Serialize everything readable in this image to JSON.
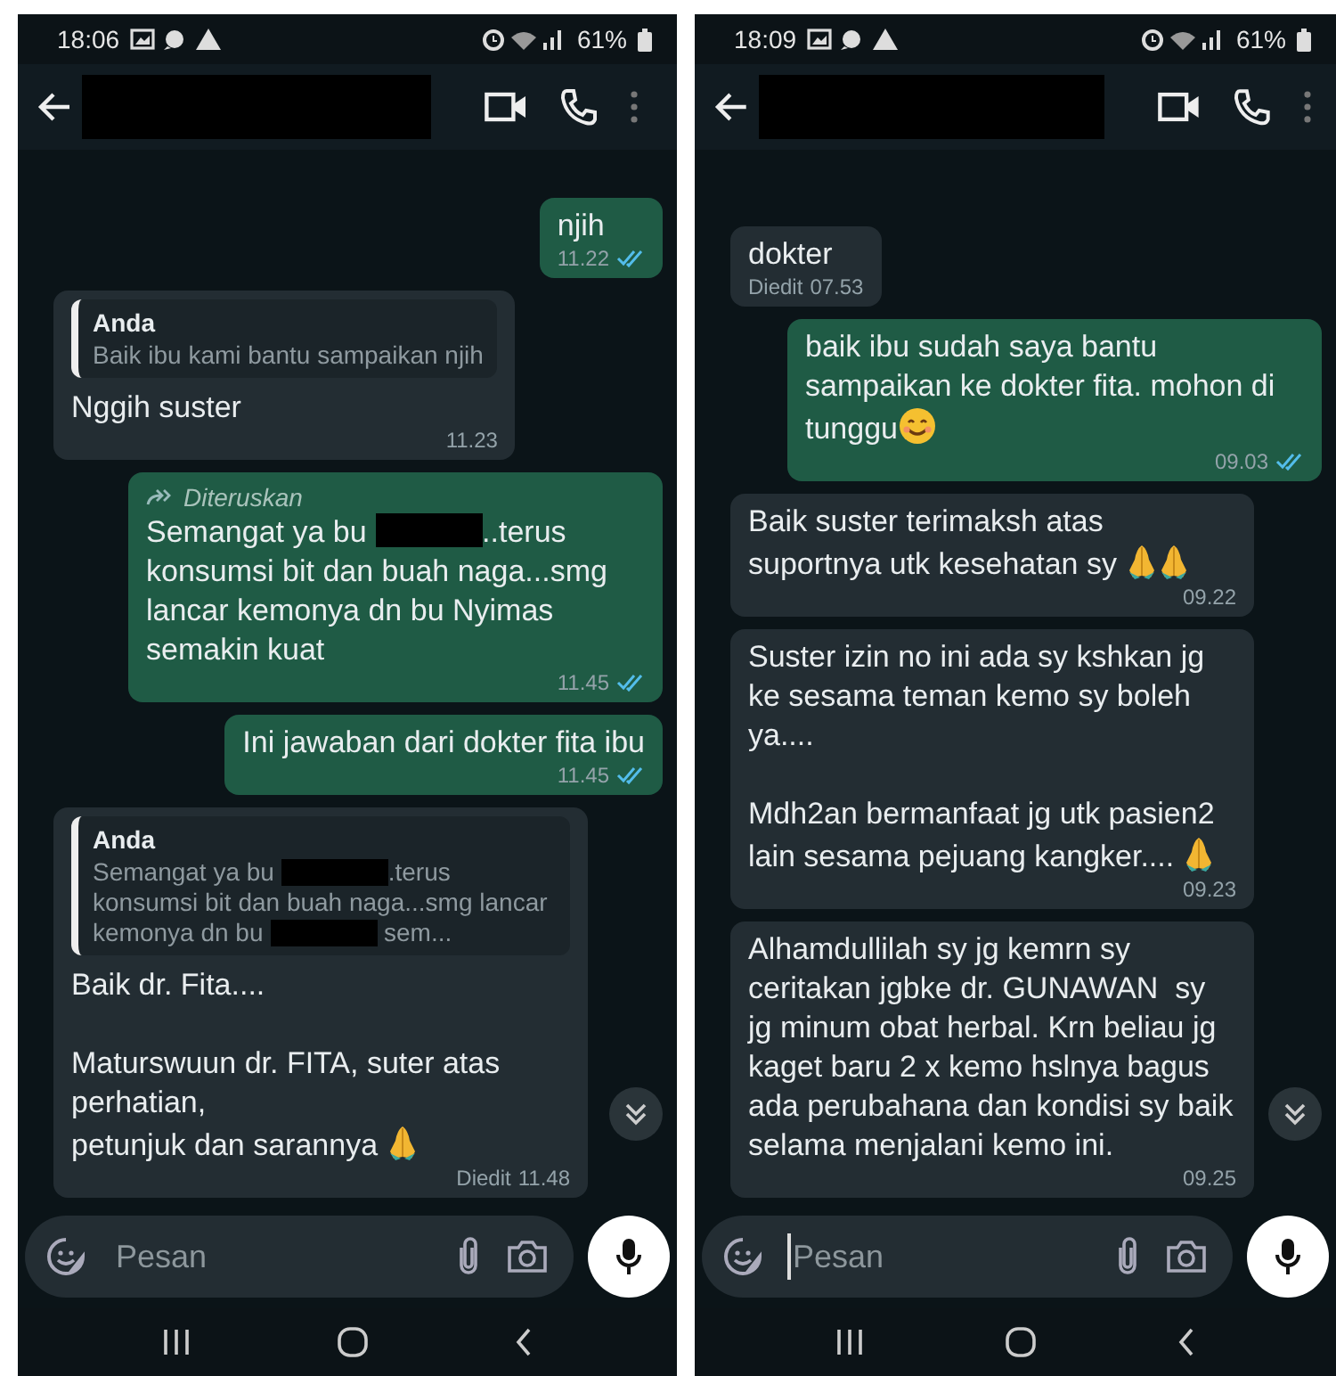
{
  "screens": [
    {
      "status_bar": {
        "time": "18:06",
        "battery": "61%"
      },
      "messages": [
        {
          "kind": "outgoing",
          "body": [
            {
              "kind": "text",
              "text": "njih"
            }
          ],
          "time": "11.22",
          "read": true
        },
        {
          "kind": "incoming",
          "quote": {
            "author": "Anda",
            "body": [
              {
                "kind": "text",
                "text": "Baik ibu kami bantu sampaikan njih"
              }
            ]
          },
          "body": [
            {
              "kind": "text",
              "text": "Nggih suster"
            }
          ],
          "time": "11.23"
        },
        {
          "kind": "outgoing",
          "forwarded_label": "Diteruskan",
          "body": [
            {
              "kind": "text",
              "text": "Semangat ya bu "
            },
            {
              "kind": "redacted"
            },
            {
              "kind": "text",
              "text": "..terus konsumsi bit dan buah naga...smg lancar kemonya dn bu Nyimas semakin kuat"
            }
          ],
          "time": "11.45",
          "read": true
        },
        {
          "kind": "outgoing",
          "body": [
            {
              "kind": "text",
              "text": "Ini jawaban dari dokter fita ibu"
            }
          ],
          "time": "11.45",
          "read": true
        },
        {
          "kind": "incoming",
          "quote": {
            "author": "Anda",
            "body": [
              {
                "kind": "text",
                "text": "Semangat ya bu "
              },
              {
                "kind": "redacted"
              },
              {
                "kind": "text",
                "text": ".terus konsumsi bit dan buah naga...smg lancar kemonya dn bu "
              },
              {
                "kind": "redacted"
              },
              {
                "kind": "text",
                "text": " sem..."
              }
            ]
          },
          "body": [
            {
              "kind": "text",
              "text": "Baik dr. Fita....\n\nMaturswuun dr. FITA, suter atas perhatian,\npetunjuk dan sarannya "
            },
            {
              "kind": "pray"
            }
          ],
          "edited_label": "Diedit",
          "time": "11.48"
        }
      ],
      "input": {
        "placeholder": "Pesan",
        "focused": false
      }
    },
    {
      "status_bar": {
        "time": "18:09",
        "battery": "61%"
      },
      "messages": [
        {
          "kind": "incoming",
          "body": [
            {
              "kind": "text",
              "text": "dokter"
            }
          ],
          "edited_label": "Diedit",
          "time": "07.53"
        },
        {
          "kind": "outgoing",
          "body": [
            {
              "kind": "text",
              "text": "baik ibu sudah saya bantu sampaikan ke dokter fita. mohon di tunggu"
            },
            {
              "kind": "smile"
            }
          ],
          "time": "09.03",
          "read": true
        },
        {
          "kind": "incoming",
          "body": [
            {
              "kind": "text",
              "text": "Baik suster terimaksh atas suportnya utk kesehatan sy "
            },
            {
              "kind": "pray"
            },
            {
              "kind": "pray"
            }
          ],
          "time": "09.22"
        },
        {
          "kind": "incoming",
          "body": [
            {
              "kind": "text",
              "text": "Suster izin no ini ada sy kshkan jg ke sesama teman kemo sy boleh ya....\n\nMdh2an bermanfaat jg utk pasien2 lain sesama pejuang kangker.... "
            },
            {
              "kind": "pray"
            }
          ],
          "time": "09.23"
        },
        {
          "kind": "incoming",
          "body": [
            {
              "kind": "text",
              "text": "Alhamdullilah sy jg kemrn sy ceritakan jgbke dr. GUNAWAN  sy jg minum obat herbal. Krn beliau jg kaget baru 2 x kemo hslnya bagus ada perubahana dan kondisi sy baik selama menjalani kemo ini."
            }
          ],
          "time": "09.25"
        }
      ],
      "input": {
        "placeholder": "Pesan",
        "focused": true
      }
    }
  ]
}
